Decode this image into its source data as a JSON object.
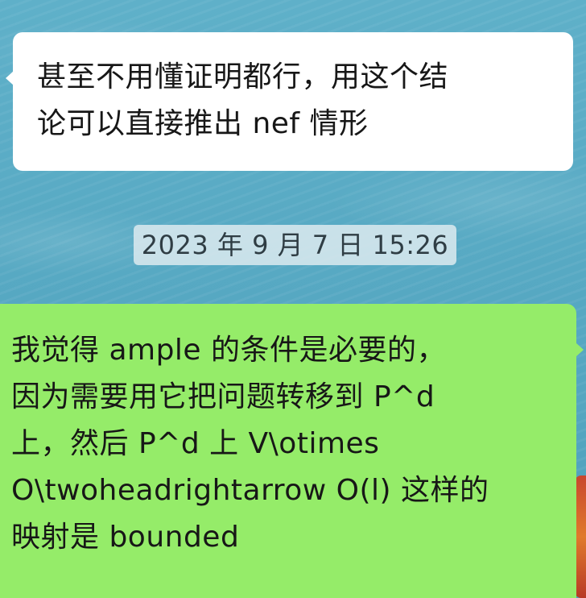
{
  "colors": {
    "background": "#57a9c3",
    "incoming_bubble": "#ffffff",
    "outgoing_bubble": "#95ec69",
    "timestamp_pill": "#d8e8ee",
    "text": "#171717"
  },
  "messages": [
    {
      "direction": "incoming",
      "lines": [
        "甚至不用懂证明都行，用这个结",
        "论可以直接推出 nef 情形"
      ]
    },
    {
      "direction": "outgoing",
      "lines": [
        "我觉得 ample 的条件是必要的，",
        "因为需要用它把问题转移到 P^d",
        "上，然后 P^d 上 V\\otimes",
        "O\\twoheadrightarrow O(l) 这样的",
        "映射是 bounded"
      ]
    }
  ],
  "timestamp": "2023 年 9 月 7 日 15:26"
}
